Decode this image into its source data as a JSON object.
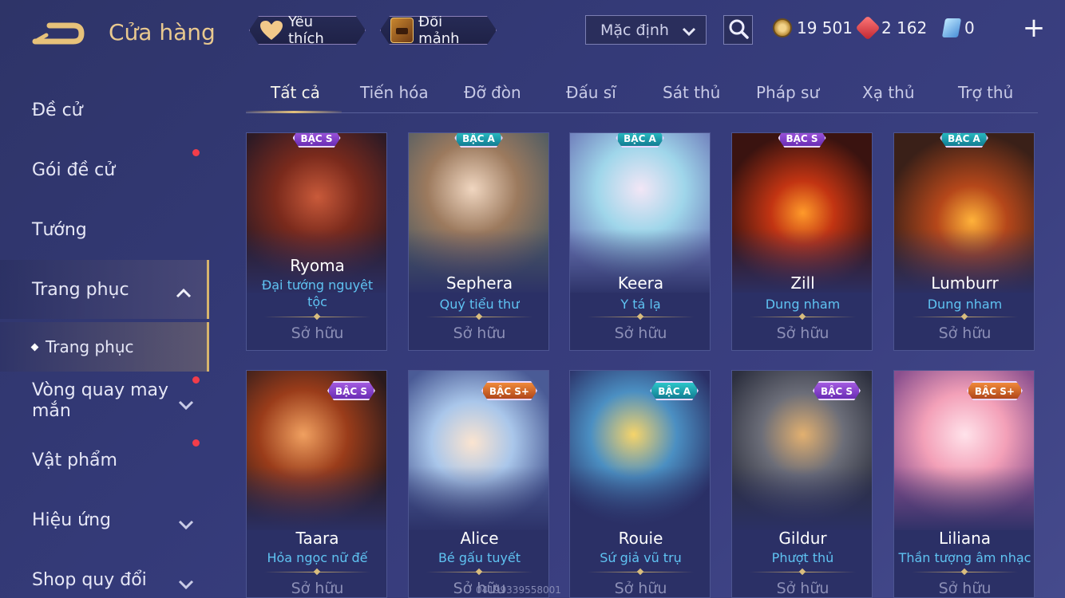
{
  "header": {
    "title": "Cửa hàng",
    "favorites_label": "Yêu thích",
    "exchange_label": "Đổi mảnh",
    "sort_selected": "Mặc định",
    "currencies": {
      "gold": "19 501",
      "ruby": "2 162",
      "voucher": "0"
    },
    "plus_label": "+"
  },
  "sidebar": {
    "items": [
      {
        "label": "Đề cử"
      },
      {
        "label": "Gói đề cử"
      },
      {
        "label": "Tướng"
      },
      {
        "label": "Trang phục"
      },
      {
        "label": "Trang phục"
      },
      {
        "label": "Vòng quay may mắn"
      },
      {
        "label": "Vật phẩm"
      },
      {
        "label": "Hiệu ứng"
      },
      {
        "label": "Shop quy đổi"
      }
    ]
  },
  "tabs": [
    {
      "label": "Tất cả"
    },
    {
      "label": "Tiến hóa"
    },
    {
      "label": "Đỡ đòn"
    },
    {
      "label": "Đấu sĩ"
    },
    {
      "label": "Sát thủ"
    },
    {
      "label": "Pháp sư"
    },
    {
      "label": "Xạ thủ"
    },
    {
      "label": "Trợ thủ"
    }
  ],
  "cards": [
    {
      "hero": "Ryoma",
      "skin": "Đại tướng nguyệt tộc",
      "tier": "BẬC S",
      "status": "Sở hữu"
    },
    {
      "hero": "Sephera",
      "skin": "Quý tiểu thư",
      "tier": "BẬC A",
      "status": "Sở hữu"
    },
    {
      "hero": "Keera",
      "skin": "Y tá lạ",
      "tier": "BẬC A",
      "status": "Sở hữu"
    },
    {
      "hero": "Zill",
      "skin": "Dung nham",
      "tier": "BẬC S",
      "status": "Sở hữu"
    },
    {
      "hero": "Lumburr",
      "skin": "Dung nham",
      "tier": "BẬC A",
      "status": "Sở hữu"
    },
    {
      "hero": "Taara",
      "skin": "Hỏa ngọc nữ đế",
      "tier": "BẬC S",
      "status": "Sở hữu"
    },
    {
      "hero": "Alice",
      "skin": "Bé gấu tuyết",
      "tier": "BẬC S+",
      "status": "Sở hữu"
    },
    {
      "hero": "Rouie",
      "skin": "Sứ giả vũ trụ",
      "tier": "BẬC A",
      "status": "Sở hữu"
    },
    {
      "hero": "Gildur",
      "skin": "Phượt thủ",
      "tier": "BẬC S",
      "status": "Sở hữu"
    },
    {
      "hero": "Liliana",
      "skin": "Thần tượng âm nhạc",
      "tier": "BẬC S+",
      "status": "Sở hữu"
    }
  ],
  "watermark": "04199339558001",
  "colors": {
    "accent_gold": "#d7b46c",
    "skin_name_blue": "#5fc3f2",
    "notification_red": "#f23d4a"
  }
}
